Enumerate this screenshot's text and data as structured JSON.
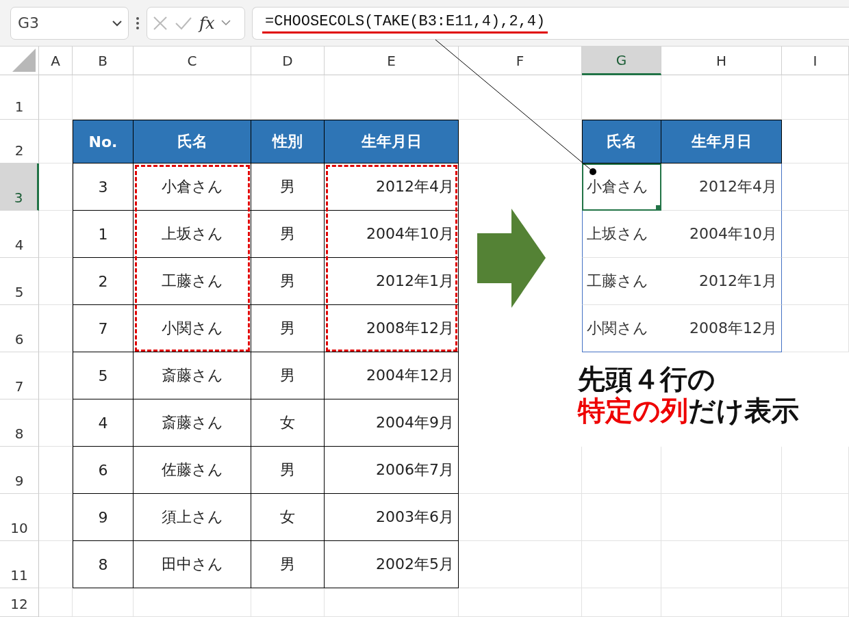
{
  "name_box": {
    "value": "G3"
  },
  "formula_bar": {
    "function_label": "fx",
    "formula": "=CHOOSECOLS(TAKE(B3:E11,4),2,4)"
  },
  "column_headers": [
    {
      "label": "A",
      "selected": false
    },
    {
      "label": "B",
      "selected": false
    },
    {
      "label": "C",
      "selected": false
    },
    {
      "label": "D",
      "selected": false
    },
    {
      "label": "E",
      "selected": false
    },
    {
      "label": "F",
      "selected": false
    },
    {
      "label": "G",
      "selected": true
    },
    {
      "label": "H",
      "selected": false
    },
    {
      "label": "I",
      "selected": false
    }
  ],
  "row_headers": [
    {
      "label": "1",
      "selected": false
    },
    {
      "label": "2",
      "selected": false
    },
    {
      "label": "3",
      "selected": true
    },
    {
      "label": "4",
      "selected": false
    },
    {
      "label": "5",
      "selected": false
    },
    {
      "label": "6",
      "selected": false
    },
    {
      "label": "7",
      "selected": false
    },
    {
      "label": "8",
      "selected": false
    },
    {
      "label": "9",
      "selected": false
    },
    {
      "label": "10",
      "selected": false
    },
    {
      "label": "11",
      "selected": false
    },
    {
      "label": "12",
      "selected": false
    }
  ],
  "source_table": {
    "columns": [
      "No.",
      "氏名",
      "性別",
      "生年月日"
    ],
    "rows": [
      [
        "3",
        "小倉さん",
        "男",
        "2012年4月"
      ],
      [
        "1",
        "上坂さん",
        "男",
        "2004年10月"
      ],
      [
        "2",
        "工藤さん",
        "男",
        "2012年1月"
      ],
      [
        "7",
        "小関さん",
        "男",
        "2008年12月"
      ],
      [
        "5",
        "斎藤さん",
        "男",
        "2004年12月"
      ],
      [
        "4",
        "斎藤さん",
        "女",
        "2004年9月"
      ],
      [
        "6",
        "佐藤さん",
        "男",
        "2006年7月"
      ],
      [
        "9",
        "須上さん",
        "女",
        "2003年6月"
      ],
      [
        "8",
        "田中さん",
        "男",
        "2002年5月"
      ]
    ]
  },
  "result_table": {
    "columns": [
      "氏名",
      "生年月日"
    ],
    "rows": [
      [
        "小倉さん",
        "2012年4月"
      ],
      [
        "上坂さん",
        "2004年10月"
      ],
      [
        "工藤さん",
        "2012年1月"
      ],
      [
        "小関さん",
        "2008年12月"
      ]
    ]
  },
  "callout": {
    "line1": "先頭４行の",
    "line2_highlight": "特定の列",
    "line2_rest": "だけ表示"
  }
}
